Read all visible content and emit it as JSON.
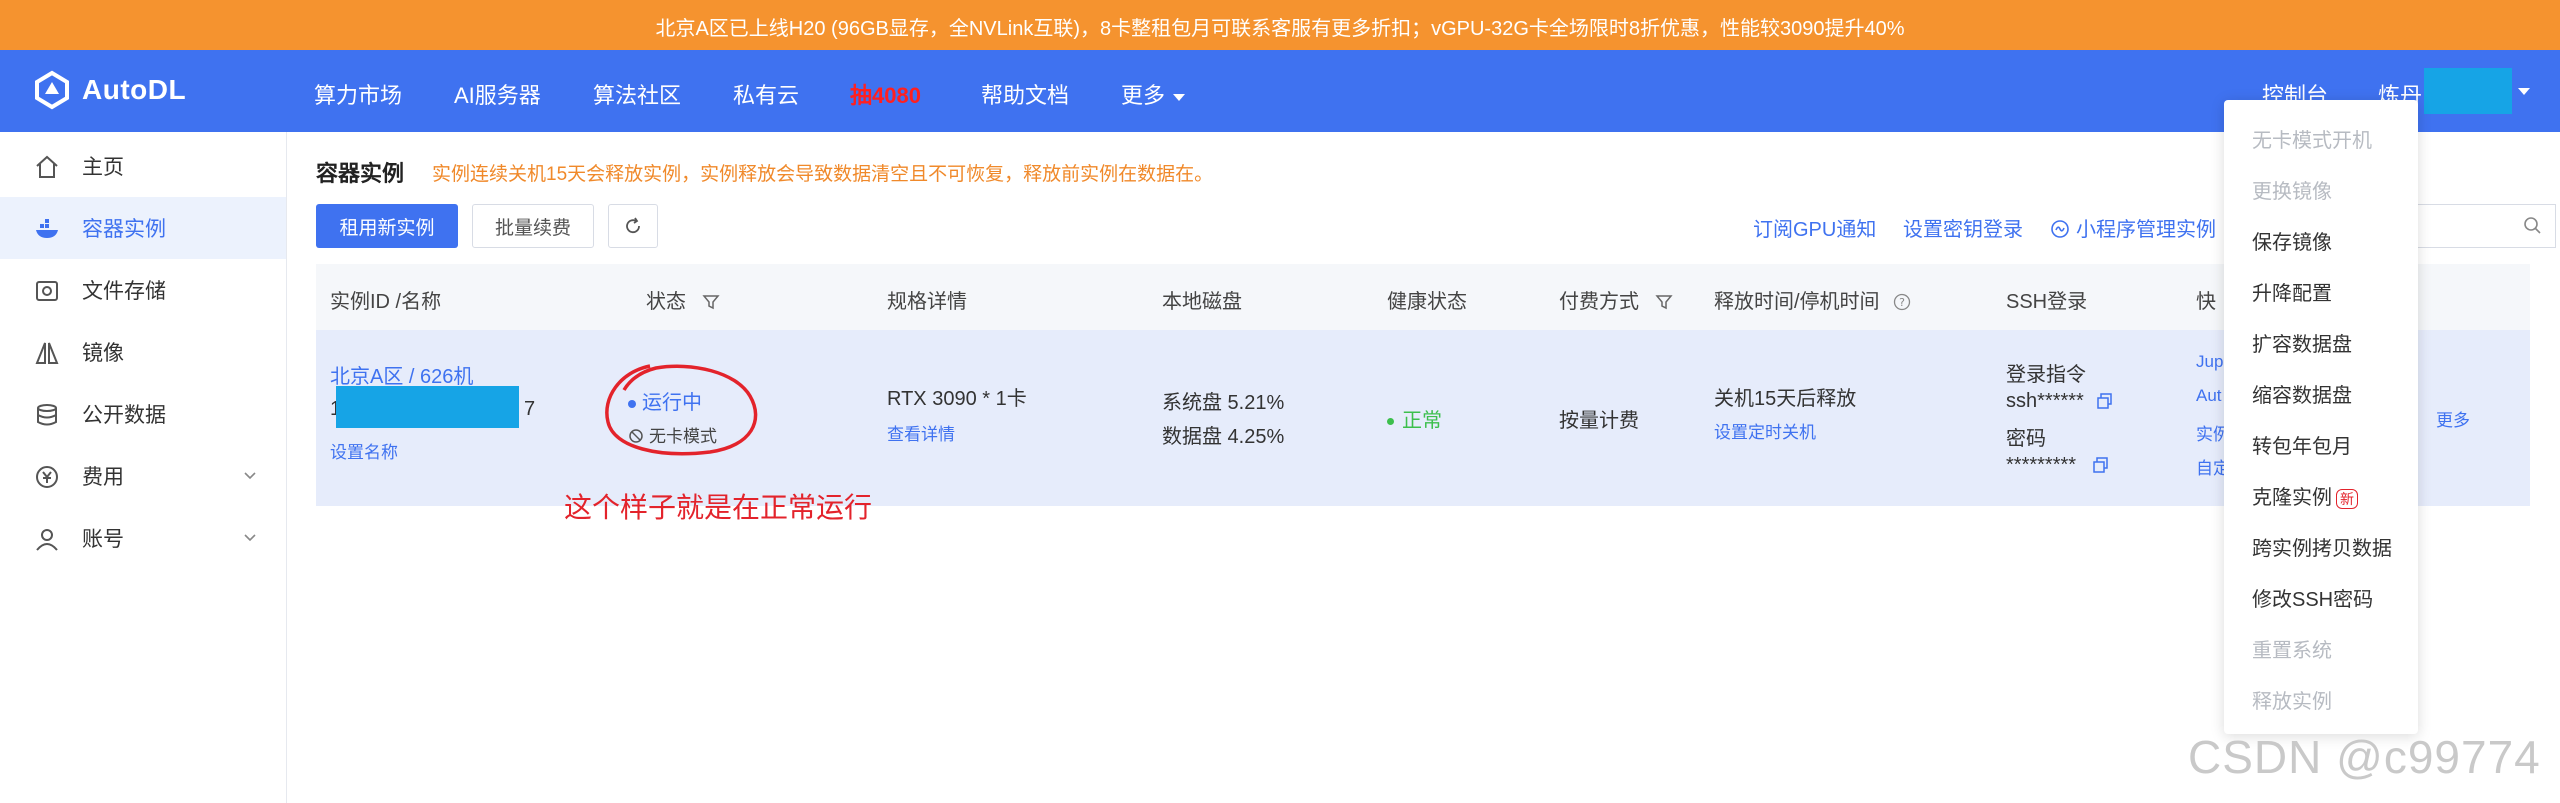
{
  "promo": {
    "text": "北京A区已上线H20 (96GB显存，全NVLink互联)，8卡整租包月可联系客服有更多折扣；vGPU-32G卡全场限时8折优惠，性能较3090提升40%"
  },
  "brand": {
    "name": "AutoDL"
  },
  "nav": {
    "items": [
      "算力市场",
      "AI服务器",
      "算法社区",
      "私有云",
      "抽4080",
      "帮助文档",
      "更多"
    ],
    "console": "控制台",
    "user_name": "炼丹"
  },
  "sidebar": {
    "items": [
      {
        "label": "主页",
        "icon": "home-icon"
      },
      {
        "label": "容器实例",
        "icon": "container-icon"
      },
      {
        "label": "文件存储",
        "icon": "storage-icon"
      },
      {
        "label": "镜像",
        "icon": "image-icon"
      },
      {
        "label": "公开数据",
        "icon": "database-icon"
      },
      {
        "label": "费用",
        "icon": "yen-icon"
      },
      {
        "label": "账号",
        "icon": "user-icon"
      }
    ]
  },
  "page": {
    "title": "容器实例",
    "warning": "实例连续关机15天会释放实例，实例释放会导致数据清空且不可恢复，释放前实例在数据在。",
    "rent_button": "租用新实例",
    "renew_button": "批量续费",
    "links": [
      "订阅GPU通知",
      "设置密钥登录",
      "小程序管理实例"
    ]
  },
  "table": {
    "headers": [
      "实例ID /名称",
      "状态",
      "规格详情",
      "本地磁盘",
      "健康状态",
      "付费方式",
      "释放时间/停机时间",
      "SSH登录",
      "快"
    ],
    "row": {
      "name": "北京A区 / 626机",
      "id_prefix": "1",
      "id_suffix": "7",
      "set_name": "设置名称",
      "status": "运行中",
      "mode": "无卡模式",
      "spec": "RTX 3090 * 1卡",
      "spec_link": "查看详情",
      "disk_sys": "系统盘 5.21%",
      "disk_data": "数据盘 4.25%",
      "health": "正常",
      "billing": "按量计费",
      "release": "关机15天后释放",
      "release_link": "设置定时关机",
      "ssh_cmd_label": "登录指令",
      "ssh_cmd": "ssh******",
      "ssh_pwd_label": "密码",
      "ssh_pwd": "*********",
      "quick": [
        "Jup",
        "Aut",
        "实例",
        "自定"
      ],
      "more": "更多"
    }
  },
  "annotation": "这个样子就是在正常运行",
  "dropdown": {
    "items": [
      {
        "label": "无卡模式开机",
        "disabled": true
      },
      {
        "label": "更换镜像",
        "disabled": true
      },
      {
        "label": "保存镜像",
        "disabled": false
      },
      {
        "label": "升降配置",
        "disabled": false
      },
      {
        "label": "扩容数据盘",
        "disabled": false
      },
      {
        "label": "缩容数据盘",
        "disabled": false
      },
      {
        "label": "转包年包月",
        "disabled": false
      },
      {
        "label": "克隆实例",
        "disabled": false,
        "badge": "新"
      },
      {
        "label": "跨实例拷贝数据",
        "disabled": false
      },
      {
        "label": "修改SSH密码",
        "disabled": false
      },
      {
        "label": "重置系统",
        "disabled": true
      },
      {
        "label": "释放实例",
        "disabled": true
      }
    ]
  },
  "watermark": "CSDN @c99774",
  "colors": {
    "primary": "#3f72f0",
    "promo": "#f5932f",
    "annotation": "#e3232b",
    "mask": "#16a4e6"
  }
}
